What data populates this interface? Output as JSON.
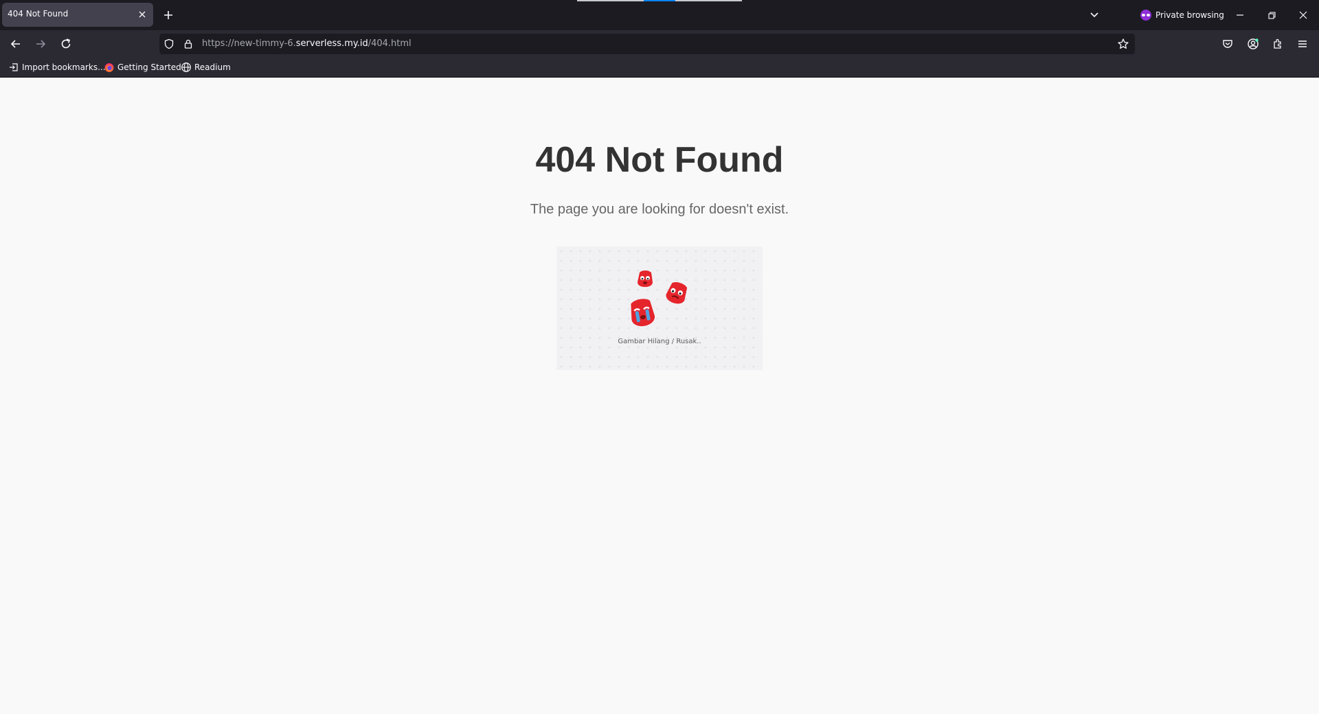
{
  "browser": {
    "tab": {
      "title": "404 Not Found"
    },
    "private_label": "Private browsing",
    "url": {
      "prefix": "https://new-timmy-6.",
      "domain": "serverless.my.id",
      "path": "/404.html"
    },
    "bookmarks": [
      {
        "label": "Import bookmarks...",
        "icon": "import-icon"
      },
      {
        "label": "Getting Started",
        "icon": "firefox-icon"
      },
      {
        "label": "Readium",
        "icon": "globe-icon"
      }
    ],
    "colors": {
      "private_accent": "#8f2fd6",
      "loading_accent": "#0a84ff"
    }
  },
  "page": {
    "title": "404 Not Found",
    "subtitle": "The page you are looking for doesn't exist.",
    "image_caption": "Gambar Hilang / Rusak..",
    "mascot_color": "#e5252c"
  }
}
